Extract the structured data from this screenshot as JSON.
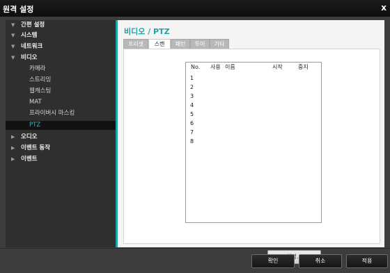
{
  "window": {
    "title": "원격 설정",
    "close_label": "x"
  },
  "sidebar": {
    "items": [
      {
        "label": "간편 설정",
        "arrow": "▼"
      },
      {
        "label": "시스템",
        "arrow": "▼"
      },
      {
        "label": "네트워크",
        "arrow": "▼"
      },
      {
        "label": "비디오",
        "arrow": "▼"
      },
      {
        "label": "카메라"
      },
      {
        "label": "스트리밍"
      },
      {
        "label": "웹캐스팅"
      },
      {
        "label": "MAT"
      },
      {
        "label": "프라이버시 마스킹"
      },
      {
        "label": "PTZ"
      },
      {
        "label": "오디오",
        "arrow": "▶"
      },
      {
        "label": "이벤트 동작",
        "arrow": "▶"
      },
      {
        "label": "이벤트",
        "arrow": "▶"
      }
    ]
  },
  "content": {
    "breadcrumb": "비디오 / PTZ",
    "tabs": [
      {
        "label": "프리셋"
      },
      {
        "label": "스캔"
      },
      {
        "label": "패턴"
      },
      {
        "label": "투어"
      },
      {
        "label": "기타"
      }
    ],
    "list": {
      "columns": [
        "No.",
        "사용",
        "이름",
        "시작",
        "중지"
      ],
      "rows": [
        "1",
        "2",
        "3",
        "4",
        "5",
        "6",
        "7",
        "8"
      ]
    },
    "setup_button": "설정..."
  },
  "footer": {
    "ok": "확인",
    "cancel": "취소",
    "apply": "적용"
  },
  "colors": {
    "accent": "#1aa6a3",
    "titlebar": "#141414",
    "sidebar_bg": "#2f2f2f",
    "selected_bg": "#121212"
  }
}
